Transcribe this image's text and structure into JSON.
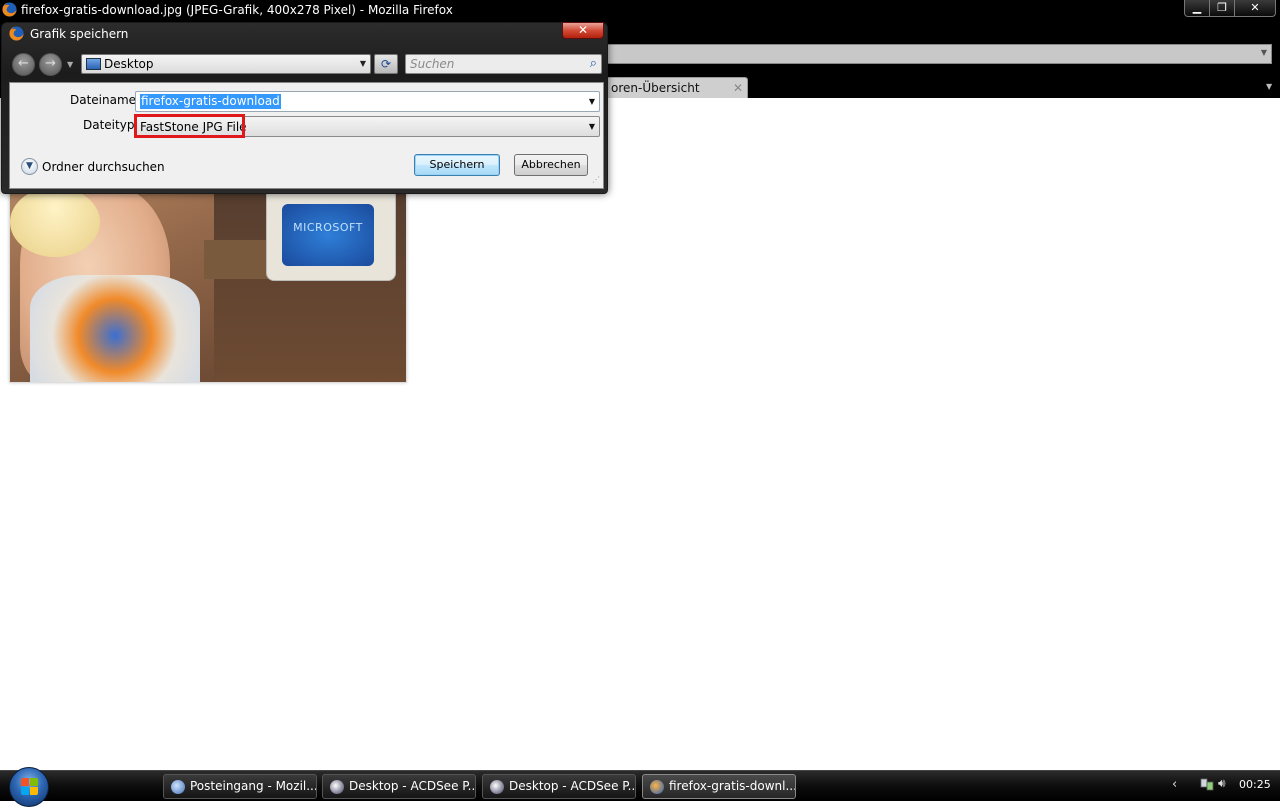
{
  "firefox": {
    "window_title": "firefox-gratis-download.jpg (JPEG-Grafik, 400x278 Pixel) - Mozilla Firefox",
    "tab_label": "oren-Übersicht",
    "controls": {
      "minimize": "▁",
      "maximize": "❐",
      "close": "✕"
    },
    "image_text": "MICROSOFT"
  },
  "dialog": {
    "title": "Grafik speichern",
    "close_label": "✕",
    "location": "Desktop",
    "search_placeholder": "Suchen",
    "filename_label": "Dateiname:",
    "filename_value": "firefox-gratis-download",
    "filetype_label": "Dateityp:",
    "filetype_value": "FastStone JPG File",
    "browse_label": "Ordner durchsuchen",
    "save_button": "Speichern",
    "cancel_button": "Abbrechen",
    "icons": {
      "back": "back-arrow-icon",
      "forward": "forward-arrow-icon",
      "refresh": "refresh-icon",
      "search": "search-icon",
      "location": "desktop-icon"
    }
  },
  "taskbar": {
    "items": [
      {
        "label": "Posteingang - Mozil...",
        "icon": "thunderbird-icon"
      },
      {
        "label": "Desktop - ACDSee P...",
        "icon": "acdsee-icon"
      },
      {
        "label": "Desktop - ACDSee P...",
        "icon": "acdsee-icon"
      },
      {
        "label": "firefox-gratis-downl...",
        "icon": "firefox-icon"
      }
    ],
    "clock": "00:25"
  },
  "colors": {
    "highlight_red": "#e0181b",
    "selection_blue": "#3399ff",
    "chrome_black": "#000000"
  }
}
